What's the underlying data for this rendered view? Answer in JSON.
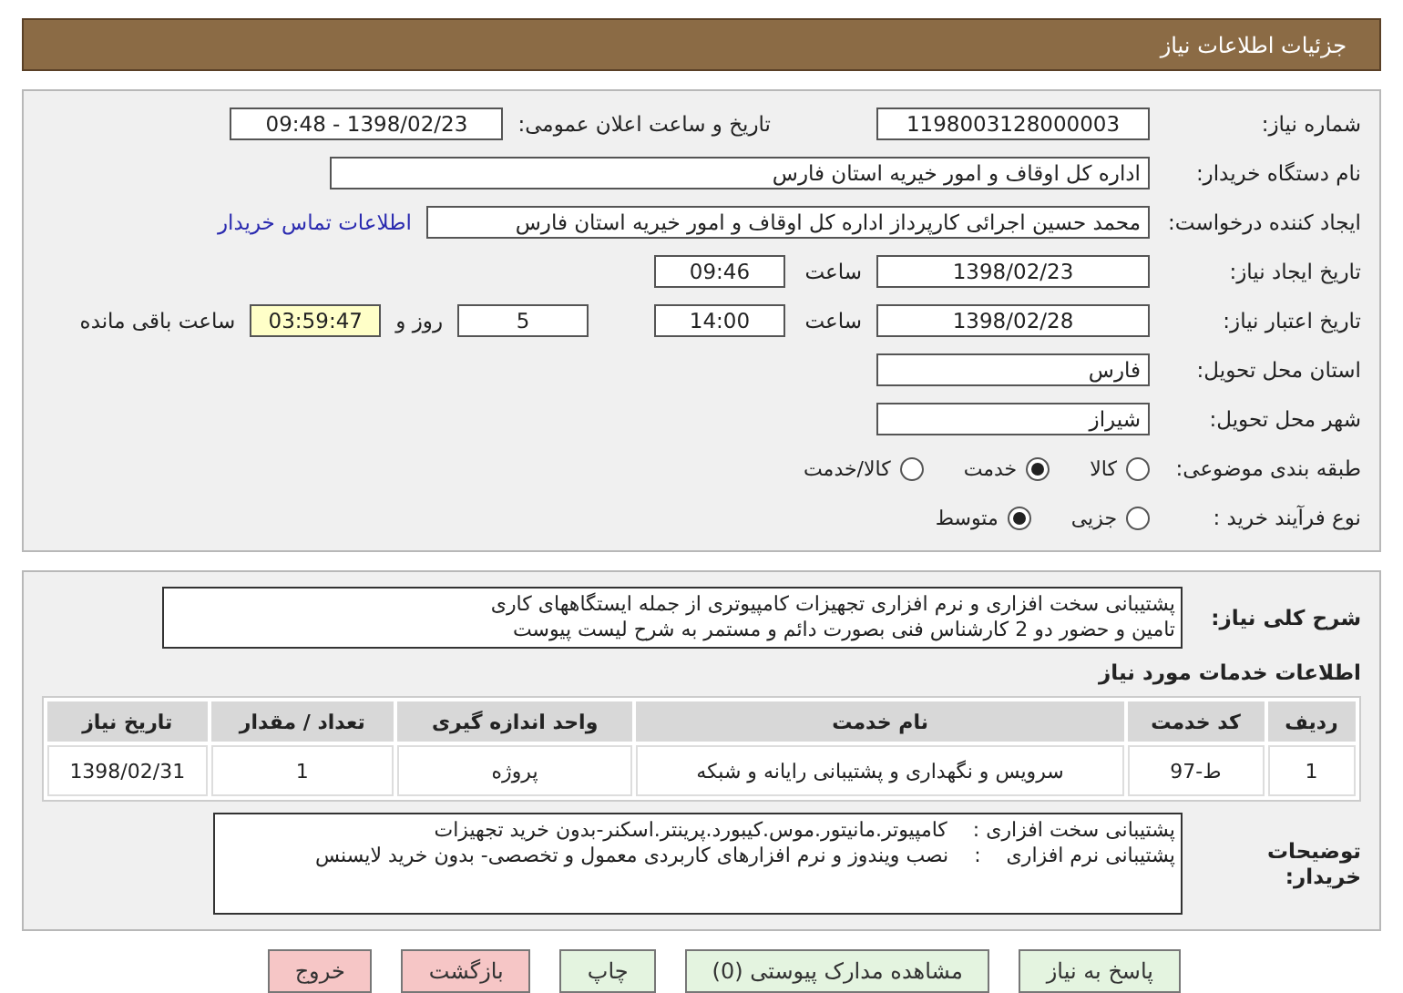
{
  "header": {
    "title": "جزئیات اطلاعات نیاز"
  },
  "fields": {
    "need_number": {
      "label": "شماره نیاز:",
      "value": "1198003128000003"
    },
    "announce": {
      "label": "تاریخ و ساعت اعلان عمومی:",
      "value": "1398/02/23 - 09:48"
    },
    "buyer": {
      "label": "نام دستگاه خریدار:",
      "value": "اداره کل اوقاف و امور خیریه استان فارس"
    },
    "requester": {
      "label": "ایجاد کننده درخواست:",
      "value": "محمد حسین اجرائی کارپرداز اداره کل اوقاف و امور خیریه استان فارس",
      "link": "اطلاعات تماس خریدار"
    },
    "created": {
      "label": "تاریخ ایجاد نیاز:",
      "date": "1398/02/23",
      "time_label": "ساعت",
      "time": "09:46"
    },
    "validity": {
      "label": "تاریخ اعتبار نیاز:",
      "date": "1398/02/28",
      "time_label": "ساعت",
      "time": "14:00",
      "days": "5",
      "days_label": "روز و",
      "remaining": "03:59:47",
      "remaining_label": "ساعت باقی مانده"
    },
    "province": {
      "label": "استان محل تحویل:",
      "value": "فارس"
    },
    "city": {
      "label": "شهر محل تحویل:",
      "value": "شیراز"
    }
  },
  "category": {
    "label": "طبقه بندی موضوعی:",
    "options": [
      {
        "label": "کالا",
        "selected": false
      },
      {
        "label": "خدمت",
        "selected": true
      },
      {
        "label": "کالا/خدمت",
        "selected": false
      }
    ]
  },
  "process": {
    "label": "نوع فرآیند خرید :",
    "options": [
      {
        "label": "جزیی",
        "selected": false
      },
      {
        "label": "متوسط",
        "selected": true
      }
    ]
  },
  "description": {
    "label": "شرح کلی نیاز:",
    "lines": [
      "پشتیبانی سخت افزاری و نرم افزاری تجهیزات کامپیوتری از جمله ایستگاههای کاری",
      "تامین و حضور دو 2 کارشناس فنی بصورت دائم و مستمر به شرح لیست پیوست"
    ]
  },
  "services": {
    "title": "اطلاعات خدمات مورد نیاز",
    "columns": [
      "ردیف",
      "کد خدمت",
      "نام خدمت",
      "واحد اندازه گیری",
      "تعداد / مقدار",
      "تاریخ نیاز"
    ],
    "rows": [
      [
        "1",
        "ط-97",
        "سرویس و نگهداری و پشتیبانی رایانه و شبکه",
        "پروژه",
        "1",
        "1398/02/31"
      ]
    ]
  },
  "notes": {
    "label": "توضیحات خریدار:",
    "lines": [
      "پشتیبانی سخت افزاری :    کامپیوتر.مانیتور.موس.کیبورد.پرینتر.اسکنر-بدون خرید تجهیزات",
      "پشتیبانی نرم افزاری    :    نصب ویندوز و نرم افزارهای کاربردی معمول و تخصصی- بدون خرید لایسنس"
    ]
  },
  "buttons": [
    {
      "label": "پاسخ به نیاز",
      "kind": "normal"
    },
    {
      "label": "مشاهده مدارک پیوستی (0)",
      "kind": "normal"
    },
    {
      "label": "چاپ",
      "kind": "normal"
    },
    {
      "label": "بازگشت",
      "kind": "danger"
    },
    {
      "label": "خروج",
      "kind": "danger"
    }
  ]
}
